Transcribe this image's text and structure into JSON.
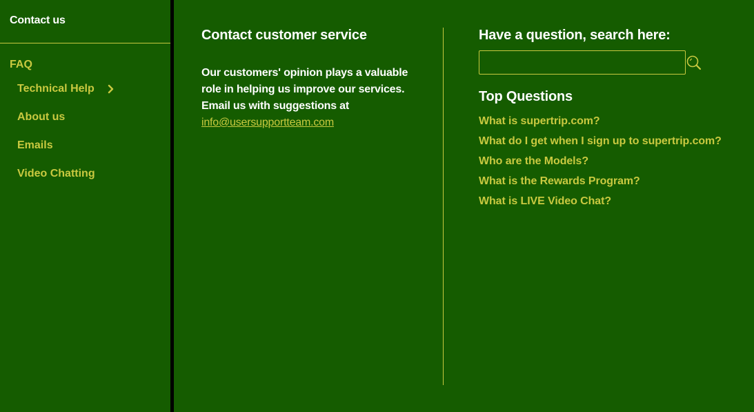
{
  "colors": {
    "background": "#155c00",
    "accent": "#c9c940",
    "divider": "#000000",
    "heading": "#ffffff"
  },
  "sidebar": {
    "title": "Contact us",
    "section": "FAQ",
    "items": [
      {
        "label": "Technical Help",
        "icon": "chevron-right-icon"
      },
      {
        "label": "About us"
      },
      {
        "label": "Emails"
      },
      {
        "label": "Video Chatting"
      }
    ]
  },
  "contact": {
    "title": "Contact customer service",
    "body_lines": [
      "Our customers' opinion plays a valuable",
      "role in helping us improve our services.",
      "Email us with suggestions at"
    ],
    "email": "info@usersupportteam.com"
  },
  "search": {
    "title": "Have a question, search here:",
    "value": "",
    "placeholder": "",
    "button_icon": "search-icon"
  },
  "top_questions": {
    "title": "Top Questions",
    "items": [
      "What is supertrip.com?",
      "What do I get when I sign up to supertrip.com?",
      "Who are the Models?",
      "What is the Rewards Program?",
      "What is LIVE Video Chat?"
    ]
  }
}
